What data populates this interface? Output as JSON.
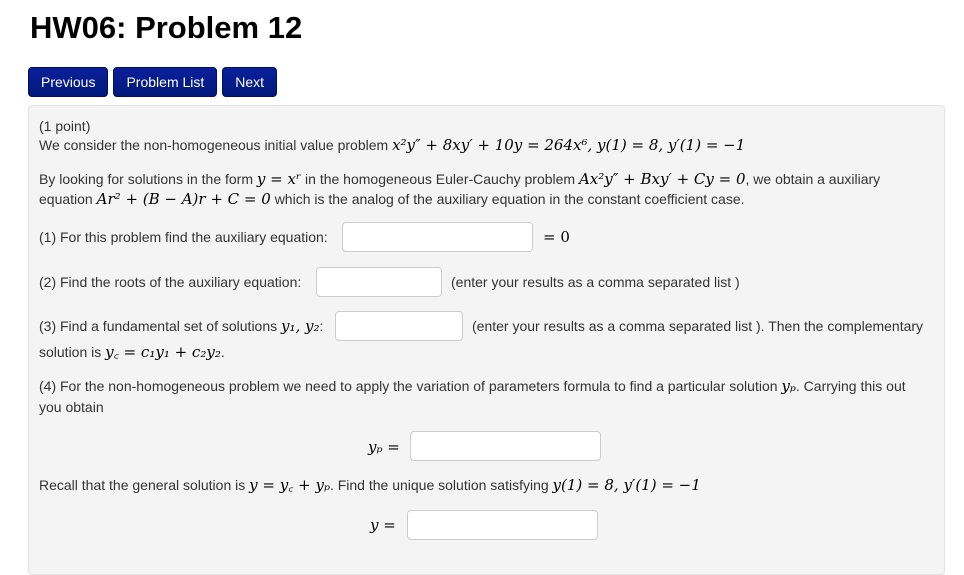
{
  "page": {
    "title": "HW06: Problem 12"
  },
  "nav": {
    "previous": "Previous",
    "problem_list": "Problem List",
    "next": "Next"
  },
  "problem": {
    "points": "(1 point)",
    "intro_text": "We consider the non-homogeneous initial value problem",
    "intro_math": "x²y″ + 8xy′ + 10y = 264x⁶,  y(1) = 8,  y′(1) = −1",
    "euler_text_1": "By looking for solutions in the form",
    "euler_math_1": "y = xʳ",
    "euler_text_2": "in the homogeneous Euler-Cauchy problem",
    "euler_math_2": "Ax²y″ + Bxy′ + Cy = 0",
    "euler_text_3": ", we obtain a auxiliary",
    "euler_text_4": "equation",
    "euler_math_3": "Ar² + (B − A)r + C = 0",
    "euler_text_5": "which is the analog of the auxiliary equation in the constant coefficient case.",
    "q1_label": "(1) For this problem find the auxiliary equation:",
    "q1_suffix": "= 0",
    "q1_value": "",
    "q2_label": "(2) Find the roots of the auxiliary equation:",
    "q2_hint": "(enter your results as a comma separated list )",
    "q2_value": "",
    "q3_label": "(3) Find a fundamental set of solutions",
    "q3_math": "y₁, y₂",
    "q3_colon": ":",
    "q3_hint": "(enter your results as a comma separated list ). Then the complementary",
    "q3_line2_text": "solution is",
    "q3_line2_math": "y꜀ = c₁y₁ + c₂y₂",
    "q3_line2_end": ".",
    "q4_text_1": "(4) For the non-homogeneous problem we need to apply the variation of parameters formula to find a particular solution",
    "q4_math": "yₚ",
    "q4_text_2": ". Carrying this out",
    "q4_text_3": "you obtain",
    "yp_label": "yₚ =",
    "yp_value": "",
    "recall_text_1": "Recall that the general solution is",
    "recall_math_1": "y = y꜀ + yₚ",
    "recall_text_2": ". Find the unique solution satisfying",
    "recall_math_2": "y(1) = 8,  y′(1) = −1",
    "y_label": "y =",
    "y_value": ""
  }
}
